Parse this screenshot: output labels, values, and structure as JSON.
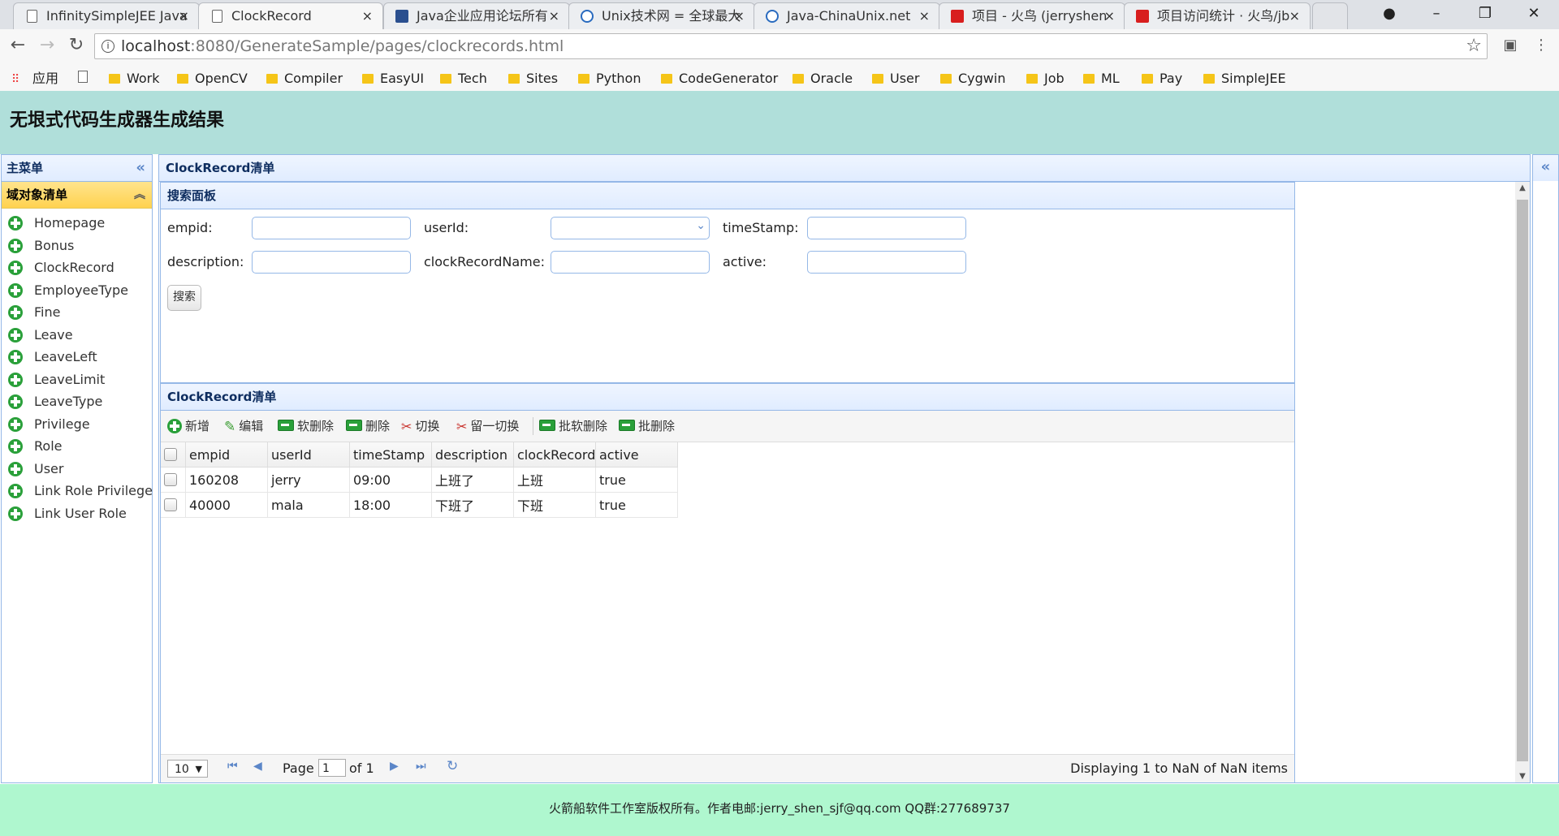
{
  "browser": {
    "tabs": [
      {
        "title": "InfinitySimpleJEE Java",
        "favicon": "doc-icon"
      },
      {
        "title": "ClockRecord",
        "favicon": "doc-icon",
        "active": true
      },
      {
        "title": "Java企业应用论坛所有",
        "favicon": "c-icon"
      },
      {
        "title": "Unix技术网 = 全球最大",
        "favicon": "u-icon"
      },
      {
        "title": "Java-ChinaUnix.net",
        "favicon": "u-icon"
      },
      {
        "title": "项目 - 火鸟 (jerryshen",
        "favicon": "g-icon"
      },
      {
        "title": "项目访问统计 · 火鸟/jb",
        "favicon": "g-icon"
      }
    ],
    "url_host": "localhost",
    "url_rest": ":8080/GenerateSample/pages/clockrecords.html",
    "bookmarks": [
      "应用",
      "Work",
      "OpenCV",
      "Compiler",
      "EasyUI",
      "Tech",
      "Sites",
      "Python",
      "CodeGenerator",
      "Oracle",
      "User",
      "Cygwin",
      "Job",
      "ML",
      "Pay",
      "SimpleJEE"
    ]
  },
  "page": {
    "title": "无垠式代码生成器生成结果",
    "footer": "火箭船软件工作室版权所有。作者电邮:jerry_shen_sjf@qq.com QQ群:277689737"
  },
  "west": {
    "title": "主菜单",
    "accordion_title": "域对象清单",
    "items": [
      "Homepage",
      "Bonus",
      "ClockRecord",
      "EmployeeType",
      "Fine",
      "Leave",
      "LeaveLeft",
      "LeaveLimit",
      "LeaveType",
      "Privilege",
      "Role",
      "User",
      "Link Role Privilege",
      "Link User Role"
    ]
  },
  "center": {
    "title": "ClockRecord清单",
    "search": {
      "title": "搜索面板",
      "labels": {
        "empid": "empid:",
        "userId": "userId:",
        "timeStamp": "timeStamp:",
        "description": "description:",
        "clockRecordName": "clockRecordName:",
        "active": "active:"
      },
      "values": {
        "empid": "",
        "userId": "",
        "timeStamp": "",
        "description": "",
        "clockRecordName": "",
        "active": ""
      },
      "button": "搜索"
    },
    "grid": {
      "title": "ClockRecord清单",
      "toolbar": {
        "add": "新增",
        "edit": "编辑",
        "soft_delete": "软删除",
        "delete": "删除",
        "toggle": "切换",
        "toggle_one": "留一切换",
        "batch_soft_delete": "批软删除",
        "batch_delete": "批删除"
      },
      "columns": [
        "empid",
        "userId",
        "timeStamp",
        "description",
        "clockRecordN",
        "active"
      ],
      "rows": [
        [
          "160208",
          "jerry",
          "09:00",
          "上班了",
          "上班",
          "true"
        ],
        [
          "40000",
          "mala",
          "18:00",
          "下班了",
          "下班",
          "true"
        ]
      ],
      "pager": {
        "page_size": "10",
        "page_label": "Page",
        "page_value": "1",
        "of_label": "of 1",
        "display": "Displaying 1 to NaN of NaN items"
      }
    }
  }
}
